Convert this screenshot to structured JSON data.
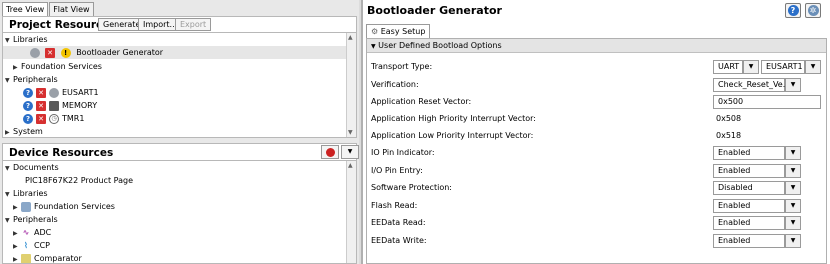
{
  "tabs": {
    "tree_view": "Tree View",
    "flat_view": "Flat View"
  },
  "project_resources": {
    "title": "Project Resources",
    "buttons": {
      "generate": "Generate",
      "import": "Import...",
      "export": "Export"
    },
    "tree": {
      "libraries": "Libraries",
      "bootloader": "Bootloader Generator",
      "foundation": "Foundation Services",
      "peripherals": "Peripherals",
      "eusart": "EUSART1",
      "memory": "MEMORY",
      "tmr": "TMR1",
      "system": "System"
    }
  },
  "device_resources": {
    "title": "Device Resources",
    "tree": {
      "documents": "Documents",
      "product_page": "PIC18F67K22 Product Page",
      "libraries": "Libraries",
      "foundation": "Foundation Services",
      "peripherals": "Peripherals",
      "adc": "ADC",
      "ccp": "CCP",
      "comparator": "Comparator"
    }
  },
  "bootloader": {
    "title": "Bootloader Generator",
    "tab": "Easy Setup",
    "section": "User Defined Bootload Options",
    "transport_label": "Transport Type:",
    "transport_type": "UART",
    "transport_port": "EUSART1",
    "verification_label": "Verification:",
    "verification_value": "Check_Reset_Ve...",
    "reset_vector_label": "Application Reset Vector:",
    "reset_vector_value": "0x500",
    "high_vector_label": "Application High Priority Interrupt Vector:",
    "high_vector_value": "0x508",
    "low_vector_label": "Application Low Priority Interrupt Vector:",
    "low_vector_value": "0x518",
    "io_indicator_label": "IO Pin Indicator:",
    "io_indicator_value": "Enabled",
    "io_entry_label": "I/O Pin Entry:",
    "io_entry_value": "Enabled",
    "sw_protect_label": "Software Protection:",
    "sw_protect_value": "Disabled",
    "flash_read_label": "Flash Read:",
    "flash_read_value": "Enabled",
    "eedata_read_label": "EEData Read:",
    "eedata_read_value": "Enabled",
    "eedata_write_label": "EEData Write:",
    "eedata_write_value": "Enabled"
  }
}
